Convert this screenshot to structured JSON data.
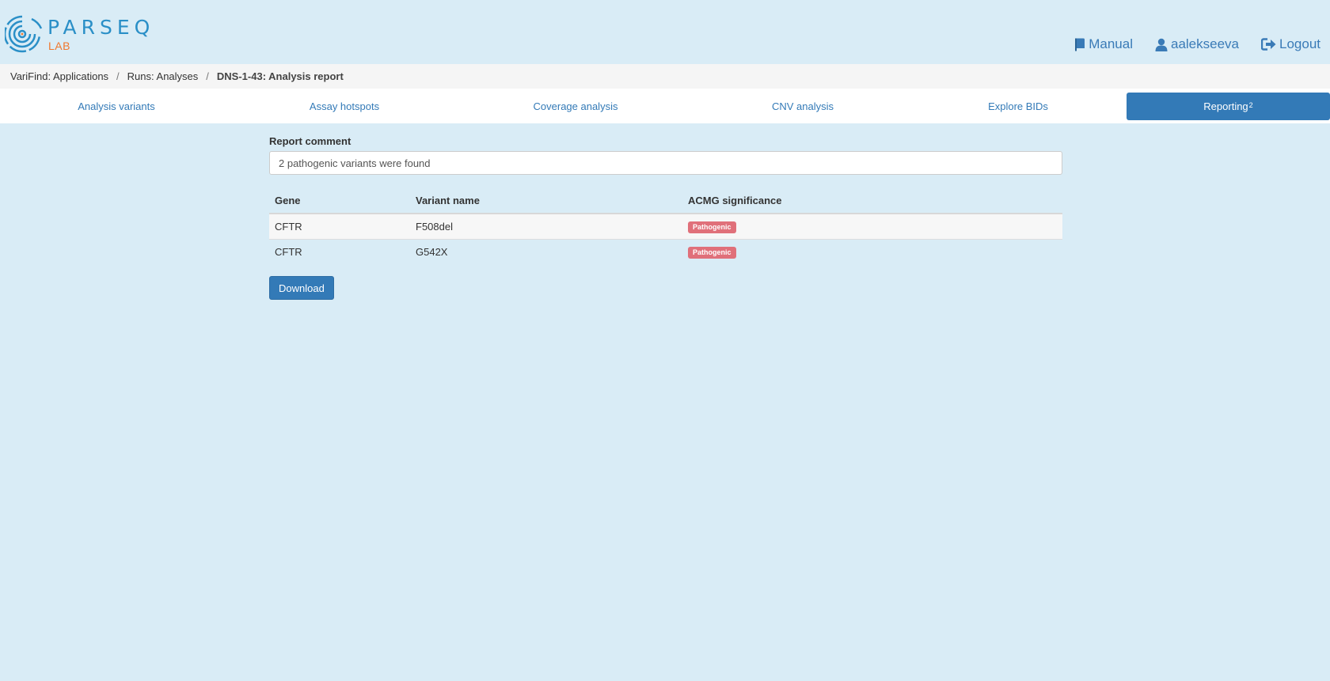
{
  "brand": {
    "name": "PARSEQ",
    "sub": "LAB",
    "colors": {
      "primary": "#2a8fc7",
      "accent": "#f0782e"
    }
  },
  "top_nav": {
    "manual": {
      "label": "Manual",
      "icon": "book-icon"
    },
    "user": {
      "label": "aalekseeva",
      "icon": "user-icon"
    },
    "logout": {
      "label": "Logout",
      "icon": "logout-icon"
    }
  },
  "breadcrumb": {
    "items": [
      "VariFind: Applications",
      "Runs: Analyses",
      "DNS-1-43: Analysis report"
    ],
    "separator": "/"
  },
  "tabs": [
    {
      "label": "Analysis variants",
      "active": false
    },
    {
      "label": "Assay hotspots",
      "active": false
    },
    {
      "label": "Coverage analysis",
      "active": false
    },
    {
      "label": "CNV analysis",
      "active": false
    },
    {
      "label": "Explore BIDs",
      "active": false
    },
    {
      "label": "Reporting",
      "badge": "2",
      "active": true
    }
  ],
  "report": {
    "comment_label": "Report comment",
    "comment_value": "2 pathogenic variants were found",
    "table": {
      "headers": [
        "Gene",
        "Variant name",
        "ACMG significance"
      ],
      "rows": [
        {
          "gene": "CFTR",
          "variant": "F508del",
          "significance": "Pathogenic"
        },
        {
          "gene": "CFTR",
          "variant": "G542X",
          "significance": "Pathogenic"
        }
      ]
    },
    "download_label": "Download"
  },
  "colors": {
    "background": "#d9ecf6",
    "active_tab": "#337ab7",
    "pathogenic_badge": "#e0707a"
  }
}
